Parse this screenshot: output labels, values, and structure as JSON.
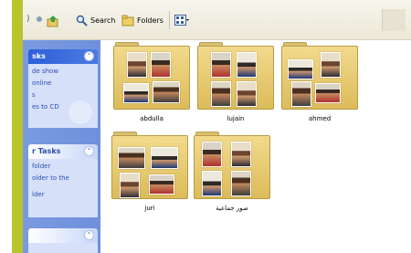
{
  "toolbar": {
    "search_label": "Search",
    "folders_label": "Folders",
    "back_icon": "back-arrow-icon",
    "up_icon": "folder-up-icon",
    "search_icon": "magnifier-icon",
    "folders_icon": "folders-icon",
    "views_icon": "views-grid-icon"
  },
  "task_pane": {
    "panel1": {
      "title": "sks",
      "items": [
        "de show",
        "online",
        "s",
        "es to CD"
      ]
    },
    "panel2": {
      "title": "r Tasks",
      "items": [
        "folder",
        "older to the",
        "",
        "lder"
      ]
    }
  },
  "folders": [
    {
      "name": "abdulla"
    },
    {
      "name": "lujain"
    },
    {
      "name": "ahmed"
    },
    {
      "name": "juri"
    },
    {
      "name": "صور جماعية"
    }
  ],
  "colors": {
    "accent_stripe": "#b9c42a",
    "task_pane_blue": "#7a9ae0",
    "folder_yellow": "#f2da8c"
  }
}
